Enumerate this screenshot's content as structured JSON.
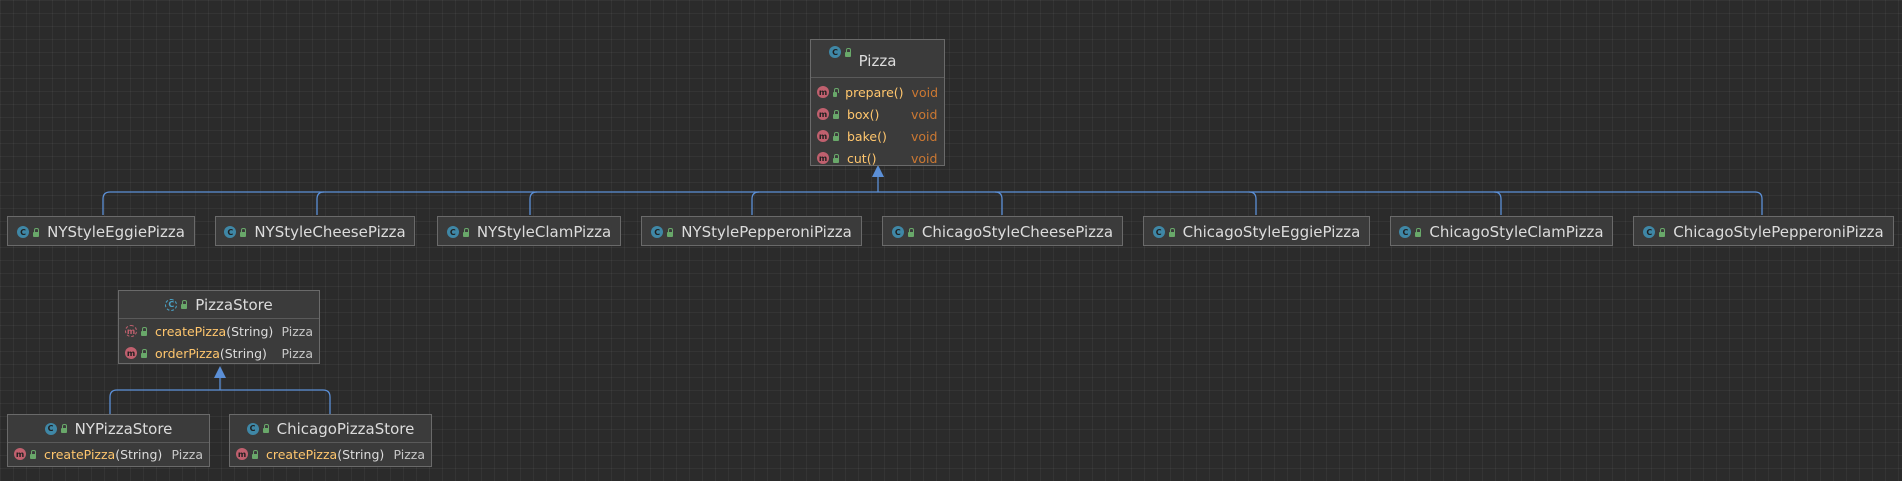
{
  "diagram": {
    "pizza": {
      "name": "Pizza",
      "methods": [
        {
          "name": "prepare()",
          "returns": "void"
        },
        {
          "name": "box()",
          "returns": "void"
        },
        {
          "name": "bake()",
          "returns": "void"
        },
        {
          "name": "cut()",
          "returns": "void"
        }
      ]
    },
    "subclasses": [
      "NYStyleEggiePizza",
      "NYStyleCheesePizza",
      "NYStyleClamPizza",
      "NYStylePepperoniPizza",
      "ChicagoStyleCheesePizza",
      "ChicagoStyleEggiePizza",
      "ChicagoStyleClamPizza",
      "ChicagoStylePepperoniPizza"
    ],
    "pizza_store": {
      "name": "PizzaStore",
      "methods": [
        {
          "name": "createPizza",
          "param": "(String)",
          "returns": "Pizza"
        },
        {
          "name": "orderPizza",
          "param": "(String)",
          "returns": "Pizza"
        }
      ]
    },
    "stores": [
      {
        "name": "NYPizzaStore",
        "method": {
          "name": "createPizza",
          "param": "(String)",
          "returns": "Pizza"
        }
      },
      {
        "name": "ChicagoPizzaStore",
        "method": {
          "name": "createPizza",
          "param": "(String)",
          "returns": "Pizza"
        }
      }
    ],
    "colors": {
      "background": "#2b2b2b",
      "node_bg": "#3b3b3b",
      "edge": "#5b8fd6",
      "method_name": "#ffc66d",
      "return_void": "#cc7832",
      "class_icon": "#3f87a6",
      "method_icon": "#c0606e"
    }
  }
}
